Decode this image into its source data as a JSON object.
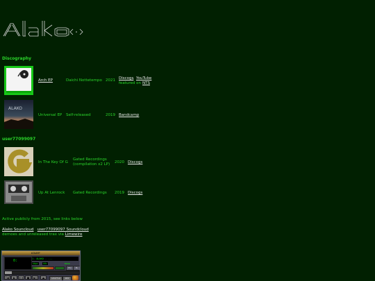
{
  "logo": {
    "text": "Alako",
    "glyph": "<·>"
  },
  "sections": {
    "discography": "Discography",
    "alias": "user77099097"
  },
  "releases": [
    {
      "title": "Arch EP",
      "label": "Daichi Nottetempo",
      "year": "2021",
      "links": [
        "Discogs",
        "YouTube"
      ],
      "featured_prefix": "featured on",
      "featured_link": "NTS"
    },
    {
      "title": "Universal EP",
      "label": "Self-released",
      "year": "2019",
      "links": [
        "Bandcamp"
      ]
    },
    {
      "title": "In The Key Of G",
      "label_line1": "Gated Recordings",
      "label_line2": "(compilation x2 LP)",
      "year": "2020",
      "links": [
        "Discogs"
      ]
    },
    {
      "title": "Up At Lenrock",
      "label": "Gated Recordings",
      "year": "2019",
      "links": [
        "Discogs"
      ]
    }
  ],
  "cover_text": {
    "universal": "ALAKO"
  },
  "info": {
    "active": "Active publicly from 2015, see links below",
    "soundcloud1": "Alako Souncloud",
    "soundcloud2": "user77099097 Soundcloud",
    "demos_prefix": "demoes and unreleased trax via",
    "demos_link": "Limewire"
  },
  "winamp": {
    "title": "WINAMP",
    "time": "0:",
    "marquee": "1. ALAKO - ...",
    "kbps": "kbps",
    "khz": "kHz",
    "mono": "mono",
    "eq": "EQ",
    "pl": "PL",
    "shuffle": "SHUFFLE",
    "repeat": "REP",
    "buttons": [
      "|◀",
      "▶",
      "❙❙",
      "■",
      "▶|",
      "⏏"
    ]
  },
  "colors": {
    "background": "#012001",
    "text": "#2bd62b",
    "link": "#e8e8e8"
  }
}
